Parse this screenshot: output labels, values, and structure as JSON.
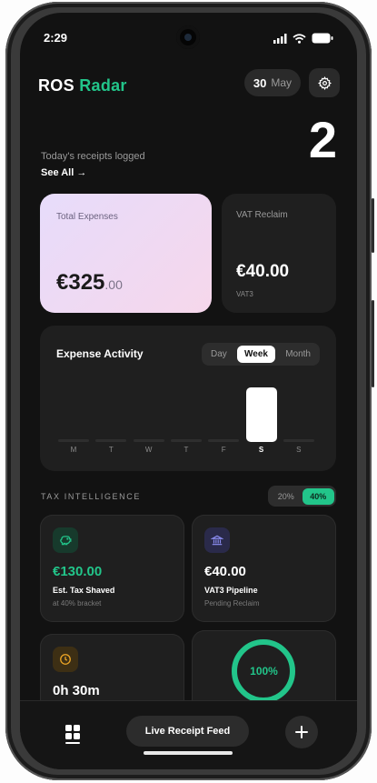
{
  "status_bar": {
    "time": "2:29"
  },
  "header": {
    "brand_main": "ROS",
    "brand_accent": "Radar",
    "date_day": "30",
    "date_month": "May"
  },
  "receipts": {
    "label": "Today's receipts logged",
    "see_all": "See All →",
    "count": "2"
  },
  "total_expenses": {
    "label": "Total Expenses",
    "amount_main": "€325",
    "amount_cents": ".00"
  },
  "vat_reclaim": {
    "label": "VAT Reclaim",
    "amount": "€40.00",
    "sub": "VAT3"
  },
  "activity": {
    "title": "Expense Activity",
    "tabs": [
      {
        "label": "Day",
        "active": false
      },
      {
        "label": "Week",
        "active": true
      },
      {
        "label": "Month",
        "active": false
      }
    ],
    "days": [
      "M",
      "T",
      "W",
      "T",
      "F",
      "S",
      "S"
    ],
    "values": [
      0,
      0,
      0,
      0,
      0,
      1,
      0
    ],
    "highlight_index": 5
  },
  "tax": {
    "title": "TAX INTELLIGENCE",
    "brackets": [
      {
        "label": "20%",
        "active": false
      },
      {
        "label": "40%",
        "active": true
      }
    ],
    "cards": [
      {
        "icon": "piggy-bank-icon",
        "value": "€130.00",
        "name": "Est. Tax Shaved",
        "note": "at 40% bracket"
      },
      {
        "icon": "bank-icon",
        "value": "€40.00",
        "name": "VAT3 Pipeline",
        "note": "Pending Reclaim"
      },
      {
        "icon": "clock-icon",
        "value": "0h 30m"
      },
      {
        "ring_label": "100%",
        "ring_percent": 100
      }
    ]
  },
  "nav": {
    "live_feed": "Live Receipt Feed"
  },
  "colors": {
    "accent": "#22c58a",
    "background": "#121212",
    "card": "#1f1f1f"
  }
}
